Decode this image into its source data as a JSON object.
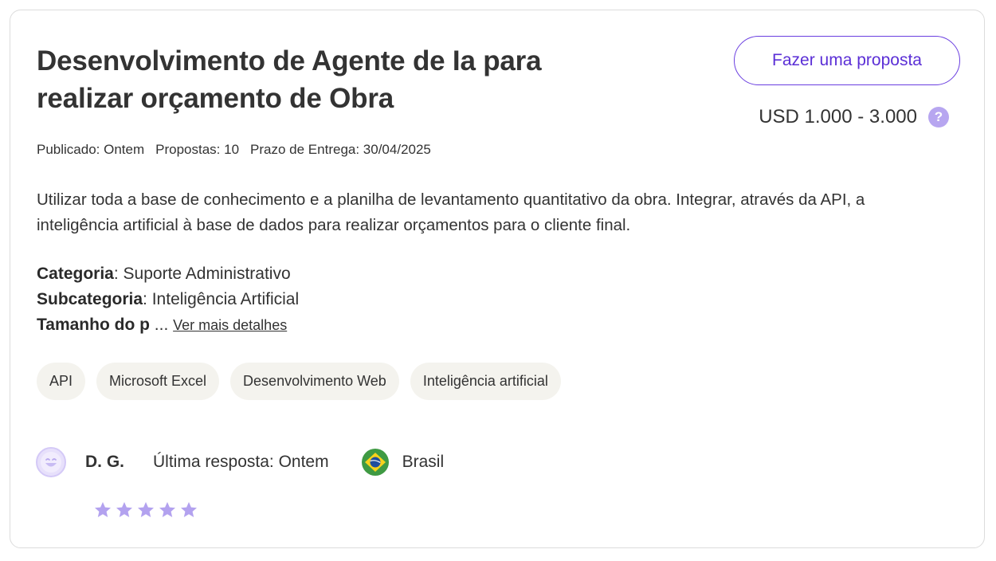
{
  "project": {
    "title": "Desenvolvimento de Agente de Ia para realizar orçamento de Obra",
    "propose_label": "Fazer uma proposta",
    "budget": "USD 1.000 - 3.000",
    "help_glyph": "?",
    "meta": {
      "published": "Publicado: Ontem",
      "proposals": "Propostas: 10",
      "deadline": "Prazo de Entrega: 30/04/2025"
    },
    "description": "Utilizar toda a base de conhecimento e a planilha de levantamento quantitativo da obra. Integrar, através da API, a inteligência artificial à base de dados para realizar orçamentos para o cliente final.",
    "details": {
      "category_label": "Categoria",
      "category_value": ": Suporte Administrativo",
      "subcategory_label": "Subcategoria",
      "subcategory_value": ": Inteligência Artificial",
      "size_label": "Tamanho do p",
      "size_ellipsis": " ... ",
      "more_link": "Ver mais detalhes"
    },
    "tags": [
      "API",
      "Microsoft Excel",
      "Desenvolvimento Web",
      "Inteligência artificial"
    ]
  },
  "client": {
    "avatar_icon": "smiley-face-icon",
    "name": "D. G.",
    "last_reply": "Última resposta: Ontem",
    "flag_icon": "brazil-flag-icon",
    "country": "Brasil",
    "rating": 5,
    "rating_max": 5
  },
  "colors": {
    "accent": "#5b2fd6",
    "star": "#b3a2ef",
    "tag_bg": "#f4f3ee",
    "border": "#dcdcdc"
  }
}
